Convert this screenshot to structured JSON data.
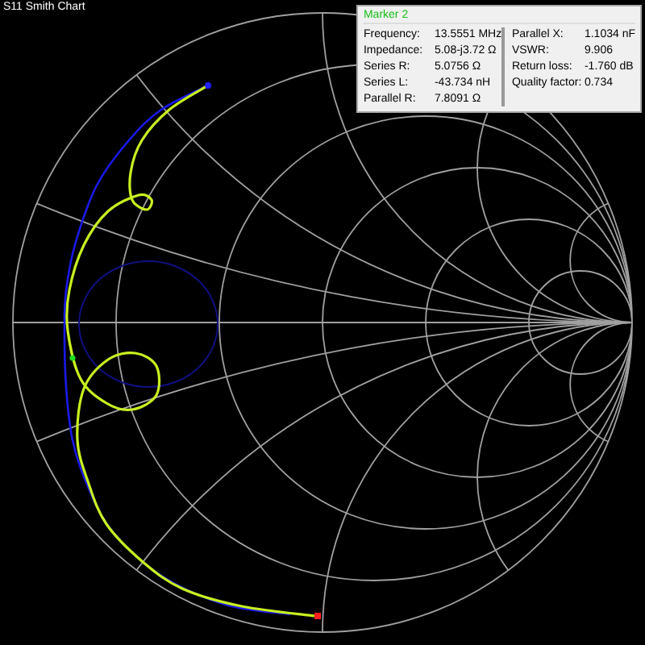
{
  "title": "S11 Smith Chart",
  "marker": {
    "title": "Marker 2",
    "left": [
      {
        "label": "Frequency:",
        "value": "13.5551 MHz"
      },
      {
        "label": "Impedance:",
        "value": "5.08-j3.72 Ω"
      },
      {
        "label": "Series R:",
        "value": "5.0756 Ω"
      },
      {
        "label": "Series L:",
        "value": "-43.734 nH"
      },
      {
        "label": "Parallel R:",
        "value": "7.8091 Ω"
      }
    ],
    "right": [
      {
        "label": "Parallel X:",
        "value": "1.1034 nF"
      },
      {
        "label": "VSWR:",
        "value": "9.906"
      },
      {
        "label": "Return loss:",
        "value": "-1.760 dB"
      },
      {
        "label": "Quality factor:",
        "value": "0.734"
      }
    ]
  }
}
